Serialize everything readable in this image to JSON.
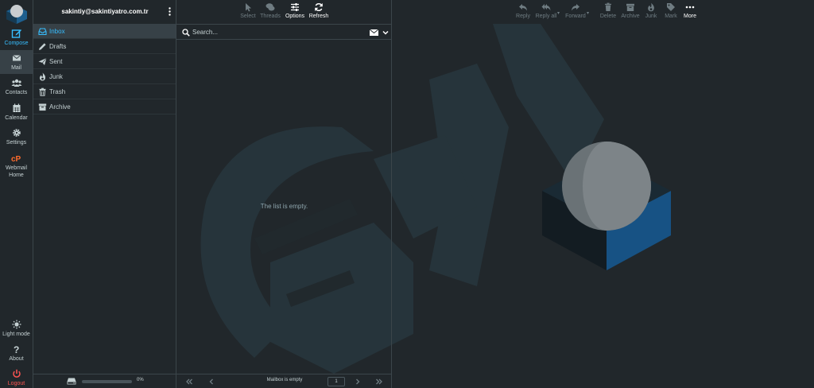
{
  "account": {
    "email": "sakintiy@sakintiyatro.com.tr"
  },
  "nav": {
    "compose": "Compose",
    "mail": "Mail",
    "contacts": "Contacts",
    "calendar": "Calendar",
    "settings": "Settings",
    "webmail_home_line1": "Webmail",
    "webmail_home_line2": "Home",
    "light_mode": "Light mode",
    "about": "About",
    "logout": "Logout"
  },
  "folders": [
    {
      "label": "Inbox",
      "icon": "inbox-icon",
      "active": true
    },
    {
      "label": "Drafts",
      "icon": "pencil-icon"
    },
    {
      "label": "Sent",
      "icon": "paper-plane-icon"
    },
    {
      "label": "Junk",
      "icon": "fire-icon"
    },
    {
      "label": "Trash",
      "icon": "trash-icon"
    },
    {
      "label": "Archive",
      "icon": "archive-box-icon"
    }
  ],
  "quota": {
    "percent_text": "0%",
    "fraction": 0.0
  },
  "list_toolbar": {
    "select": "Select",
    "threads": "Threads",
    "options": "Options",
    "refresh": "Refresh"
  },
  "search": {
    "placeholder": "Search..."
  },
  "list": {
    "empty_text": "The list is empty."
  },
  "pager": {
    "status": "Mailbox is empty",
    "page": "1"
  },
  "preview_toolbar": {
    "reply": "Reply",
    "reply_all": "Reply all",
    "forward": "Forward",
    "delete": "Delete",
    "archive": "Archive",
    "junk": "Junk",
    "mark": "Mark",
    "more": "More"
  },
  "colors": {
    "accent": "#37beff",
    "logout": "#ff5552",
    "cpanel": "#ff6c2c",
    "background": "#21272b",
    "active_bg": "#374147"
  }
}
